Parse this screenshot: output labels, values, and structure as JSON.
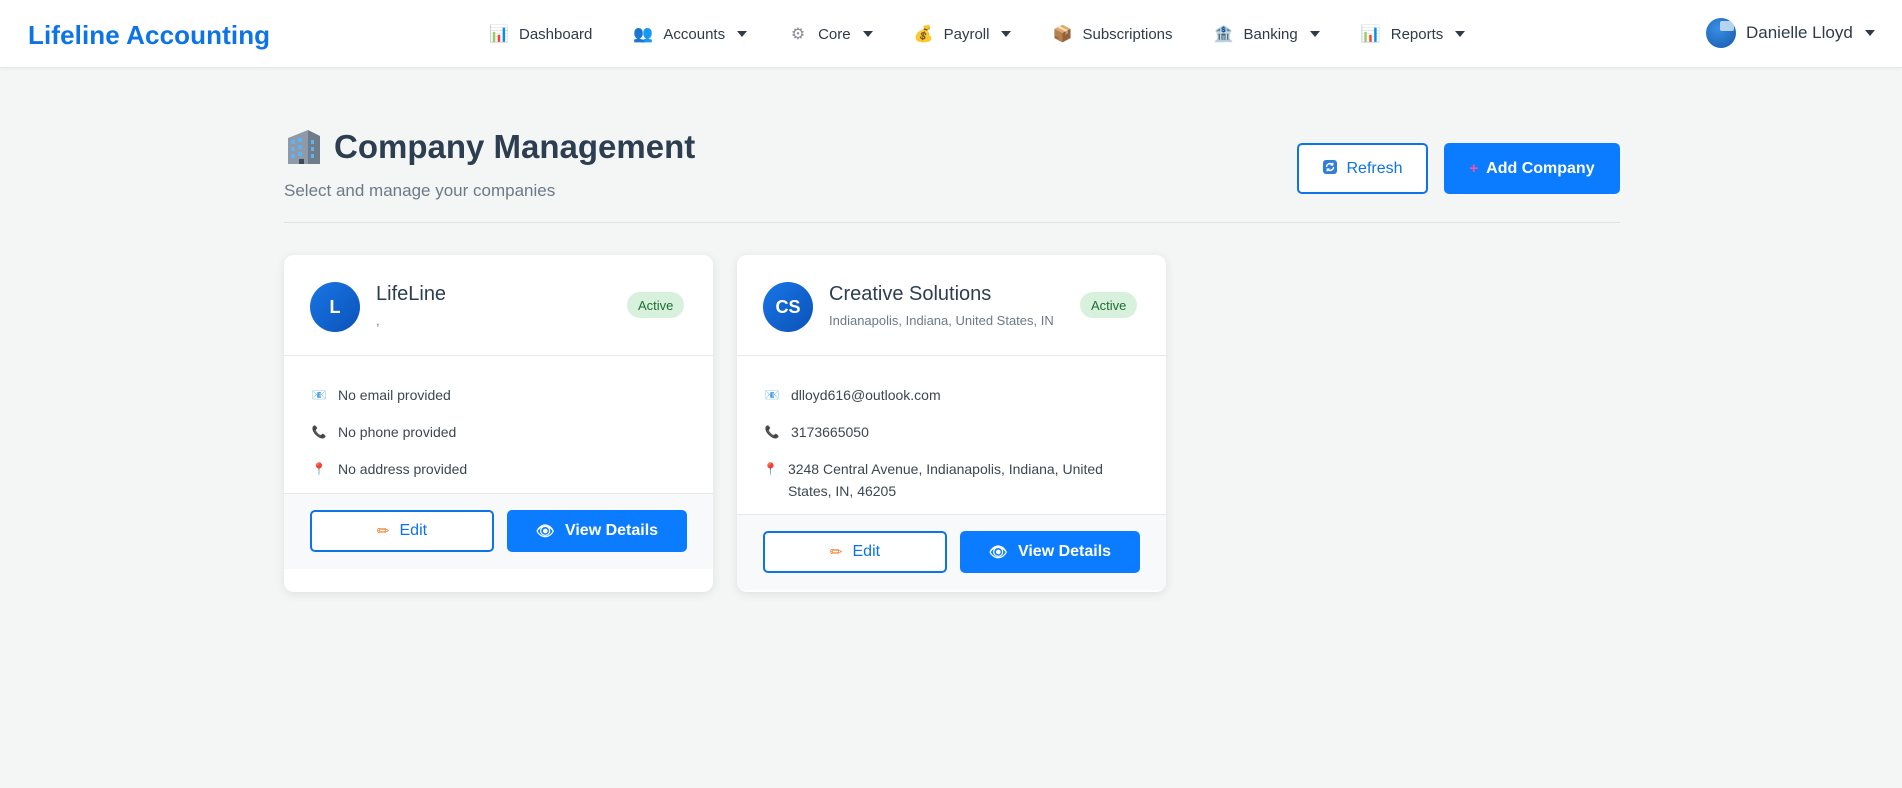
{
  "brand": "Lifeline Accounting",
  "nav": {
    "items": [
      {
        "label": "Dashboard",
        "icon": "bar-chart-icon",
        "glyph": "📊",
        "dropdown": false
      },
      {
        "label": "Accounts",
        "icon": "people-icon",
        "glyph": "👥",
        "dropdown": true
      },
      {
        "label": "Core",
        "icon": "gear-icon",
        "glyph": "⚙",
        "dropdown": true
      },
      {
        "label": "Payroll",
        "icon": "money-bag-icon",
        "glyph": "💰",
        "dropdown": true
      },
      {
        "label": "Subscriptions",
        "icon": "package-icon",
        "glyph": "📦",
        "dropdown": false
      },
      {
        "label": "Banking",
        "icon": "bank-icon",
        "glyph": "🏦",
        "dropdown": true
      },
      {
        "label": "Reports",
        "icon": "report-chart-icon",
        "glyph": "📊",
        "dropdown": true
      }
    ]
  },
  "user": {
    "name": "Danielle Lloyd"
  },
  "header": {
    "title": "Company Management",
    "subtitle": "Select and manage your companies",
    "refresh_label": "Refresh",
    "add_label": "Add Company"
  },
  "companies": [
    {
      "initials": "L",
      "name": "LifeLine",
      "location": ",",
      "status": "Active",
      "email": "No email provided",
      "phone": "No phone provided",
      "address": "No address provided",
      "edit_label": "Edit",
      "view_label": "View Details"
    },
    {
      "initials": "CS",
      "name": "Creative Solutions",
      "location": "Indianapolis, Indiana, United States, IN",
      "status": "Active",
      "email": "dlloyd616@outlook.com",
      "phone": "3173665050",
      "address": "3248 Central Avenue, Indianapolis, Indiana, United States, IN, 46205",
      "edit_label": "Edit",
      "view_label": "View Details"
    }
  ],
  "colors": {
    "primary": "#0b7cff",
    "brand": "#0d73e8",
    "badge_bg": "#d7f1dd",
    "badge_text": "#1e6e32"
  }
}
